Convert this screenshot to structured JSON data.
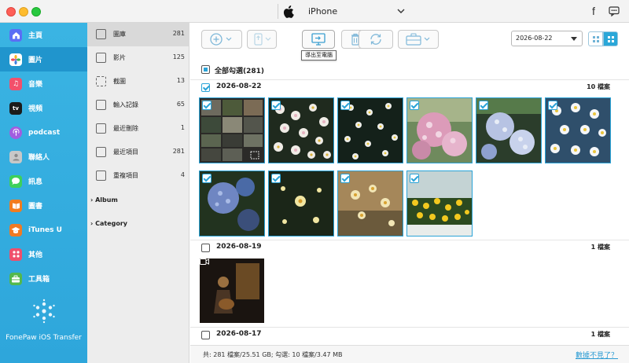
{
  "titlebar": {
    "device_name": "iPhone",
    "facebook_glyph": "f"
  },
  "sidebar": {
    "items": [
      {
        "label": "主頁",
        "icon": "home-icon",
        "color": "#5b6ef5"
      },
      {
        "label": "圖片",
        "icon": "photos-icon",
        "color": "#f0a23b"
      },
      {
        "label": "音樂",
        "icon": "music-icon",
        "color": "#f2506b"
      },
      {
        "label": "視頻",
        "icon": "tv-icon",
        "color": "#1b1b1b"
      },
      {
        "label": "podcast",
        "icon": "podcast-icon",
        "color": "#a25de0"
      },
      {
        "label": "聯絡人",
        "icon": "contacts-icon",
        "color": "#b8b8b8"
      },
      {
        "label": "訊息",
        "icon": "messages-icon",
        "color": "#3ed05a"
      },
      {
        "label": "圖書",
        "icon": "books-icon",
        "color": "#f27c1f"
      },
      {
        "label": "iTunes U",
        "icon": "itunes-u-icon",
        "color": "#f07a23"
      },
      {
        "label": "其他",
        "icon": "other-icon",
        "color": "#ef4f6c"
      },
      {
        "label": "工具箱",
        "icon": "toolbox-icon",
        "color": "#53b84c"
      }
    ],
    "brand": "FonePaw iOS Transfer"
  },
  "categories": {
    "items": [
      {
        "label": "圖庫",
        "count": "281"
      },
      {
        "label": "影片",
        "count": "125"
      },
      {
        "label": "截圖",
        "count": "13"
      },
      {
        "label": "輸入記錄",
        "count": "65"
      },
      {
        "label": "最近刪除",
        "count": "1"
      },
      {
        "label": "最近項目",
        "count": "281"
      },
      {
        "label": "重複項目",
        "count": "4"
      }
    ],
    "groups": [
      {
        "label": "Album"
      },
      {
        "label": "Category"
      }
    ]
  },
  "toolbar": {
    "export_tooltip": "導出至電腦",
    "date_value": "2026-08-22"
  },
  "content": {
    "select_all_label": "全部勾選(281)",
    "groups": [
      {
        "date": "2026-08-22",
        "count": "10 檔案"
      },
      {
        "date": "2026-08-19",
        "count": "1 檔案"
      },
      {
        "date": "2026-08-17",
        "count": "1 檔案"
      }
    ]
  },
  "status": {
    "summary": "共: 281 檔案/25.51 GB; 勾選: 10 檔案/3.47 MB",
    "missing_link": "數據不見了？"
  },
  "colors": {
    "accent": "#2aa3d7",
    "sidebar": "#33ade0"
  }
}
